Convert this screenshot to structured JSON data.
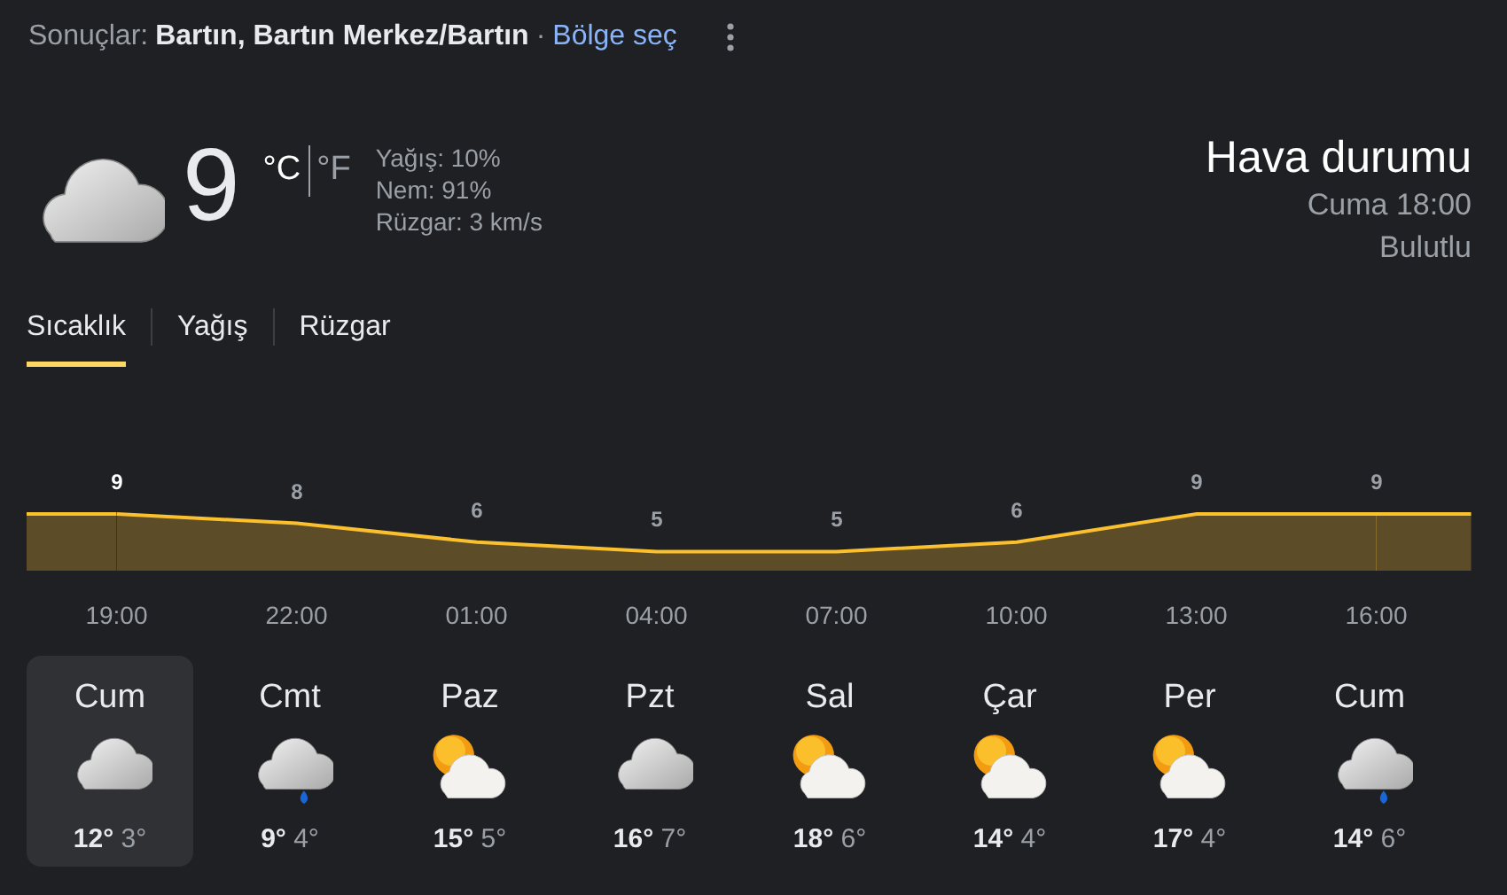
{
  "header": {
    "label": "Sonuçlar:",
    "location": "Bartın, Bartın Merkez/Bartın",
    "separator": "·",
    "link": "Bölge seç"
  },
  "current": {
    "kind": "cloudy",
    "temperature": "9",
    "units": [
      {
        "label": "°C",
        "selected": true
      },
      {
        "label": "°F",
        "selected": false
      }
    ],
    "details": [
      "Yağış: 10%",
      "Nem: 91%",
      "Rüzgar: 3 km/s"
    ],
    "title": "Hava durumu",
    "time": "Cuma 18:00",
    "condition": "Bulutlu"
  },
  "tabs": [
    {
      "label": "Sıcaklık",
      "selected": true
    },
    {
      "label": "Yağış",
      "selected": false
    },
    {
      "label": "Rüzgar",
      "selected": false
    }
  ],
  "chart_data": {
    "type": "area",
    "categories": [
      "19:00",
      "22:00",
      "01:00",
      "04:00",
      "07:00",
      "10:00",
      "13:00",
      "16:00"
    ],
    "series": [
      {
        "color": "#fbc02d",
        "values": [
          9,
          8,
          6,
          5,
          5,
          6,
          9,
          9
        ]
      }
    ],
    "data_labels": true
  },
  "days": [
    {
      "day": "Cum",
      "kind": "cloudy",
      "high": "12°",
      "low": "3°",
      "selected": true
    },
    {
      "day": "Cmt",
      "kind": "rain",
      "high": "9°",
      "low": "4°",
      "selected": false
    },
    {
      "day": "Paz",
      "kind": "partly_cloudy",
      "high": "15°",
      "low": "5°",
      "selected": false
    },
    {
      "day": "Pzt",
      "kind": "cloudy",
      "high": "16°",
      "low": "7°",
      "selected": false
    },
    {
      "day": "Sal",
      "kind": "partly_cloudy",
      "high": "18°",
      "low": "6°",
      "selected": false
    },
    {
      "day": "Çar",
      "kind": "partly_cloudy",
      "high": "14°",
      "low": "4°",
      "selected": false
    },
    {
      "day": "Per",
      "kind": "partly_cloudy",
      "high": "17°",
      "low": "4°",
      "selected": false
    },
    {
      "day": "Cum",
      "kind": "rain",
      "high": "14°",
      "low": "6°",
      "selected": false
    }
  ]
}
